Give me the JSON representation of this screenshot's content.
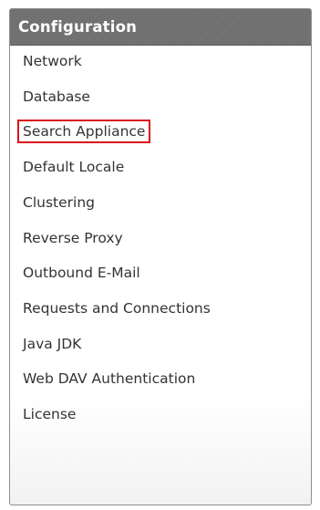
{
  "panel": {
    "title": "Configuration",
    "items": [
      {
        "label": "Network",
        "name": "network",
        "highlighted": false
      },
      {
        "label": "Database",
        "name": "database",
        "highlighted": false
      },
      {
        "label": "Search Appliance",
        "name": "search-appliance",
        "highlighted": true
      },
      {
        "label": "Default Locale",
        "name": "default-locale",
        "highlighted": false
      },
      {
        "label": "Clustering",
        "name": "clustering",
        "highlighted": false
      },
      {
        "label": "Reverse Proxy",
        "name": "reverse-proxy",
        "highlighted": false
      },
      {
        "label": "Outbound E-Mail",
        "name": "outbound-email",
        "highlighted": false
      },
      {
        "label": "Requests and Connections",
        "name": "requests-and-connections",
        "highlighted": false
      },
      {
        "label": "Java JDK",
        "name": "java-jdk",
        "highlighted": false
      },
      {
        "label": "Web DAV Authentication",
        "name": "web-dav-authentication",
        "highlighted": false
      },
      {
        "label": "License",
        "name": "license",
        "highlighted": false
      }
    ],
    "highlight_color": "#d8131c",
    "header_color": "#6e6e6e"
  }
}
